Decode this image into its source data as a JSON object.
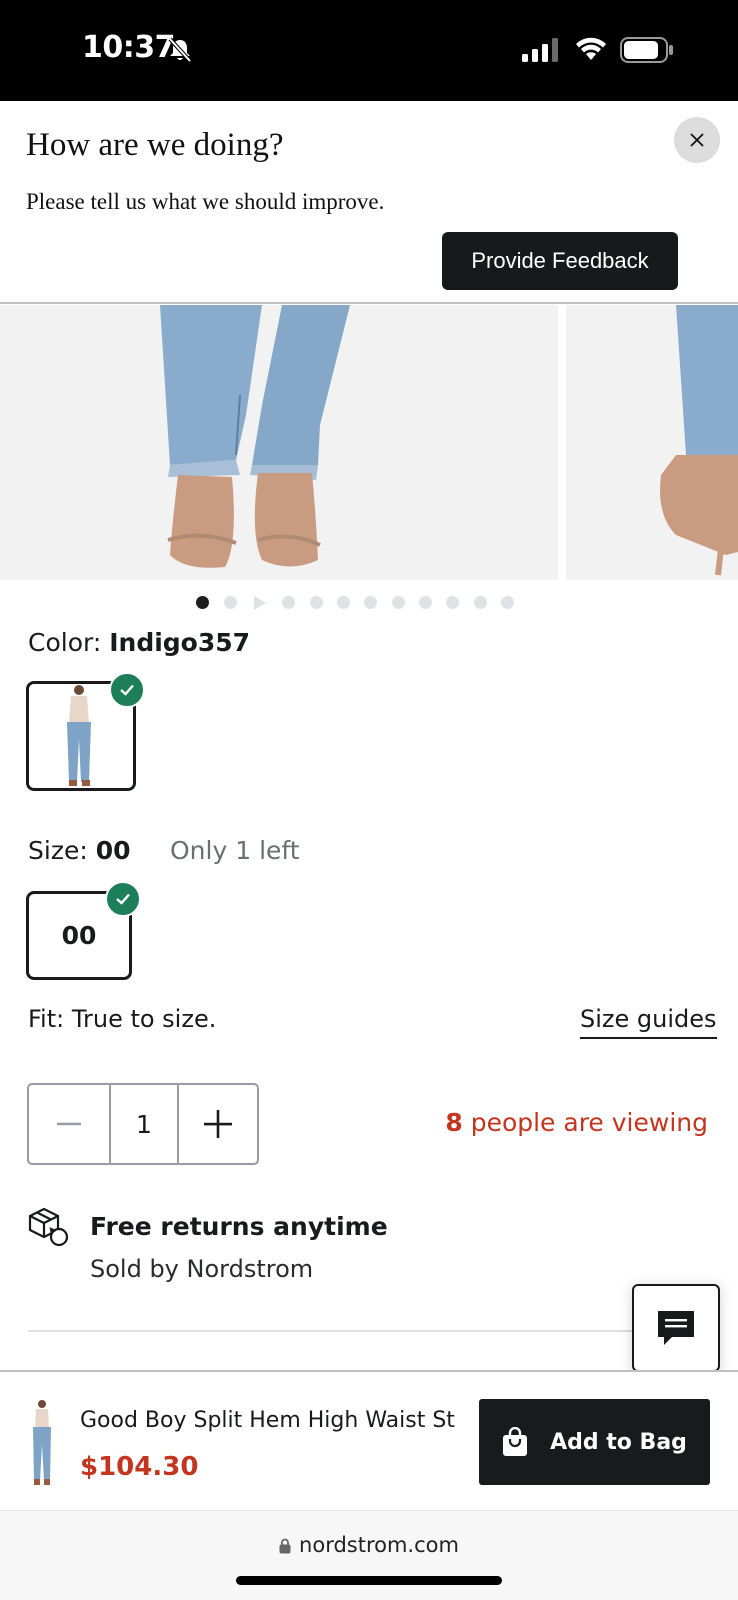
{
  "status_bar": {
    "time": "10:37",
    "icons": [
      "bell-slash-icon",
      "cellular-signal-icon",
      "wifi-icon",
      "battery-icon"
    ]
  },
  "feedback_banner": {
    "title": "How are we doing?",
    "subtitle": "Please tell us what we should improve.",
    "button_label": "Provide Feedback",
    "close_icon": "close-icon"
  },
  "gallery": {
    "image_count": 12,
    "active_index": 0
  },
  "color": {
    "label": "Color:",
    "value": "Indigo357"
  },
  "size": {
    "label": "Size:",
    "value": "00",
    "stock_note": "Only 1 left",
    "option": "00"
  },
  "fit": {
    "text": "Fit: True to size.",
    "size_guides_link": "Size guides"
  },
  "quantity": {
    "value": "1",
    "viewing_count": "8",
    "viewing_text": " people are viewing"
  },
  "returns": {
    "title": "Free returns anytime",
    "subtitle": "Sold by Nordstrom"
  },
  "sticky_bar": {
    "product_name": "Good Boy Split Hem High Waist St...",
    "price": "$104.30",
    "add_button": "Add to Bag"
  },
  "browser": {
    "url": "nordstrom.com"
  },
  "colors": {
    "accent_red": "#c4351f",
    "check_green": "#1c7f5a",
    "dark": "#191a1b"
  }
}
